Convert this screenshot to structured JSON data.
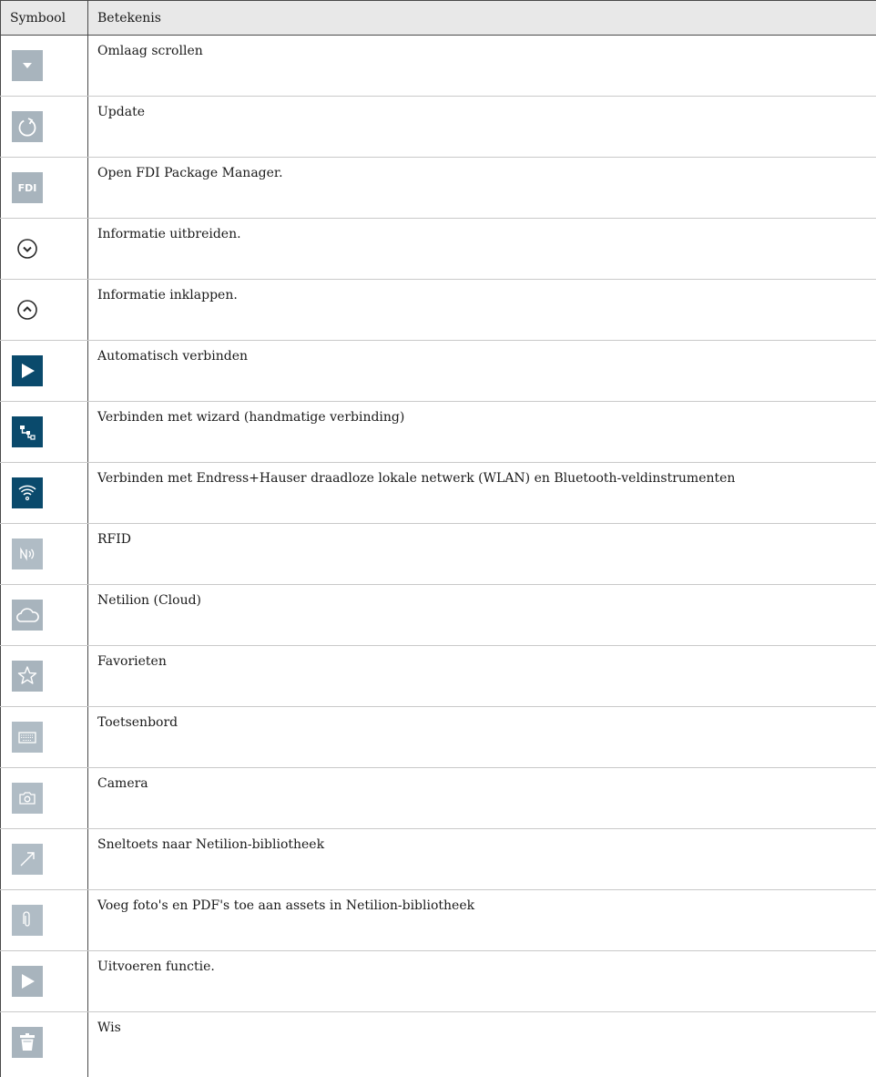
{
  "header": {
    "symbol": "Symbool",
    "meaning": "Betekenis"
  },
  "rows": [
    {
      "icon": "scroll-down-icon",
      "text": "Omlaag scrollen"
    },
    {
      "icon": "refresh-icon",
      "text": "Update"
    },
    {
      "icon": "fdi-icon",
      "icon_text": "FDI",
      "text": "Open FDI Package Manager."
    },
    {
      "icon": "expand-circle-icon",
      "text": "Informatie uitbreiden."
    },
    {
      "icon": "collapse-circle-icon",
      "text": "Informatie inklappen."
    },
    {
      "icon": "play-icon",
      "text": "Automatisch verbinden"
    },
    {
      "icon": "network-wizard-icon",
      "text": "Verbinden met wizard (handmatige verbinding)"
    },
    {
      "icon": "wifi-icon",
      "text": "Verbinden met Endress+Hauser draadloze lokale netwerk (WLAN) en Bluetooth-veldinstrumenten"
    },
    {
      "icon": "rfid-icon",
      "text": "RFID"
    },
    {
      "icon": "cloud-icon",
      "text": "Netilion (Cloud)"
    },
    {
      "icon": "star-icon",
      "text": "Favorieten"
    },
    {
      "icon": "keyboard-icon",
      "text": "Toetsenbord"
    },
    {
      "icon": "camera-icon",
      "text": "Camera"
    },
    {
      "icon": "shortcut-arrow-icon",
      "text": "Sneltoets naar Netilion-bibliotheek"
    },
    {
      "icon": "paperclip-icon",
      "text": "Voeg foto's en PDF's toe aan assets in Netilion-bibliotheek"
    },
    {
      "icon": "execute-icon",
      "text": "Uitvoeren functie."
    },
    {
      "icon": "trash-icon",
      "text": "Wis"
    }
  ],
  "colors": {
    "icon_grey": "#a8b4bd",
    "icon_navy": "#0a4a6c",
    "header_bg": "#e8e8e8"
  }
}
